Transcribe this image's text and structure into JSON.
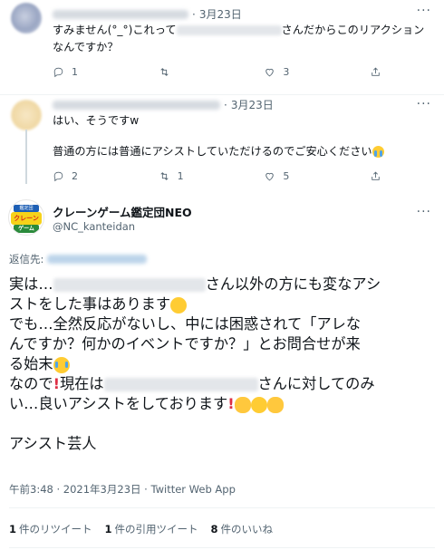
{
  "reply1": {
    "date": "3月23日",
    "text_before": "すみません(°_°)これって",
    "text_after": "さんだからこのリアクション",
    "text_line2": "なんですか？",
    "reply_count": "1",
    "retweet_count": "",
    "like_count": "3"
  },
  "reply2": {
    "date": "3月23日",
    "line1": "はい、そうですw",
    "line2": "普通の方には普通にアシストしていただけるのでご安心ください",
    "reply_count": "2",
    "retweet_count": "1",
    "like_count": "5"
  },
  "main": {
    "author_name": "クレーンゲーム鑑定団NEO",
    "handle": "@NC_kanteidan",
    "logo_top": "鑑定団",
    "logo_mid": "クレーン",
    "logo_bot": "ゲーム",
    "replying_to_label": "返信先:",
    "l1a": "実は…",
    "l1b": "さん以外の方にも変なアシ",
    "l2": "ストをした事はあります",
    "l3": "でも…全然反応がないし、中には困惑されて「アレな",
    "l4": "んですか？何かのイベントですか？」とお問合せが来",
    "l5": "る始末",
    "l6a": "なので",
    "l6b": "現在は",
    "l6c": "さんに対してのみ",
    "l7": "い…良いアシストをしております",
    "l8": "アシスト芸人",
    "timestamp": "午前3:48 · 2021年3月23日 · Twitter Web App",
    "retweets_num": "1",
    "retweets_label": "件のリツイート",
    "quotes_num": "1",
    "quotes_label": "件の引用ツイート",
    "likes_num": "8",
    "likes_label": "件のいいね"
  },
  "icons": [
    "reply-icon",
    "retweet-icon",
    "like-icon",
    "share-icon",
    "more-icon",
    "crying-face-emoji",
    "thumbs-up-emoji",
    "exclamation-emoji"
  ]
}
